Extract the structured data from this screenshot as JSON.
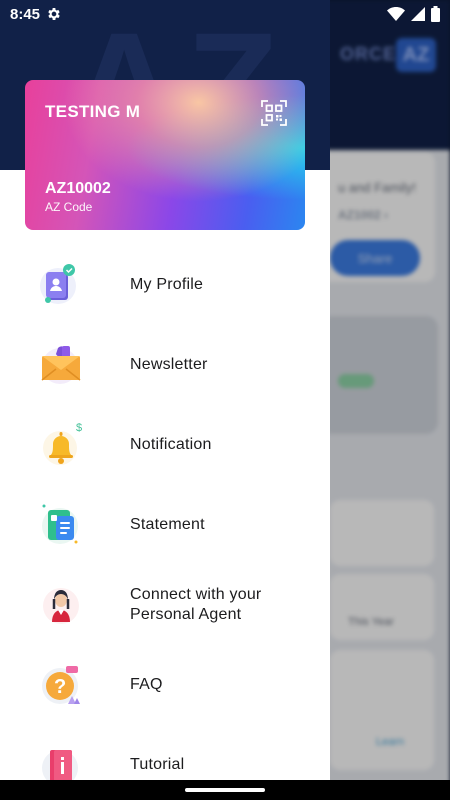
{
  "status_bar": {
    "time": "8:45"
  },
  "background": {
    "header_text": "ORCE",
    "logo_text": "AZ",
    "card_line1": "u and Family!",
    "card_line2": "AZ1002 ›",
    "button_label": "Share",
    "tile_label": "This Year",
    "link_text": "Learn"
  },
  "drawer": {
    "watermark": "AZ",
    "profile_card": {
      "name": "TESTING M",
      "code": "AZ10002",
      "code_label": "AZ Code"
    },
    "menu": [
      {
        "label": "My Profile",
        "icon": "profile-icon"
      },
      {
        "label": "Newsletter",
        "icon": "newsletter-icon"
      },
      {
        "label": "Notification",
        "icon": "notification-bell-icon"
      },
      {
        "label": "Statement",
        "icon": "statement-icon"
      },
      {
        "label": "Connect with your\nPersonal Agent",
        "icon": "agent-icon"
      },
      {
        "label": "FAQ",
        "icon": "faq-icon"
      },
      {
        "label": "Tutorial",
        "icon": "tutorial-icon"
      }
    ]
  },
  "colors": {
    "header_navy": "#112148",
    "accent_blue": "#3d7ee6",
    "card_pink": "#e8409b",
    "card_cyan": "#28dceb"
  }
}
